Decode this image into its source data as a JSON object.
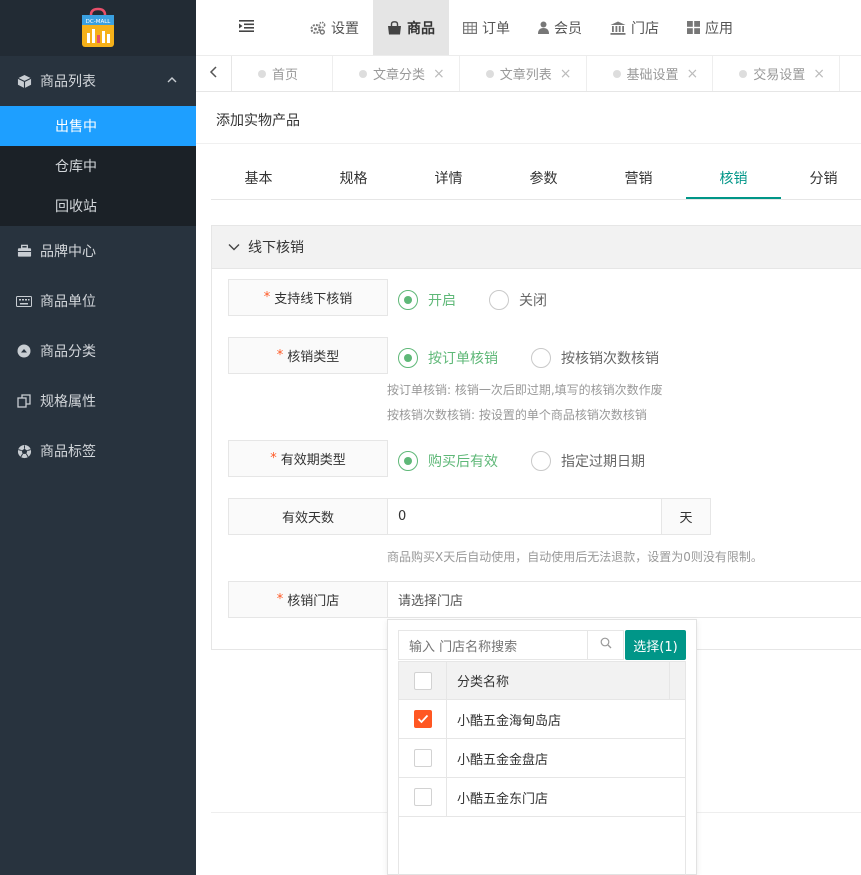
{
  "logo": {
    "text": "DC-MALL"
  },
  "sidebar": {
    "groups": [
      {
        "label": "商品列表",
        "icon": "cube-icon",
        "open": true,
        "items": [
          {
            "label": "出售中",
            "active": true
          },
          {
            "label": "仓库中",
            "active": false
          },
          {
            "label": "回收站",
            "active": false
          }
        ]
      },
      {
        "label": "品牌中心",
        "icon": "briefcase-icon"
      },
      {
        "label": "商品单位",
        "icon": "keyboard-icon"
      },
      {
        "label": "商品分类",
        "icon": "caret-circle-icon"
      },
      {
        "label": "规格属性",
        "icon": "copy-icon"
      },
      {
        "label": "商品标签",
        "icon": "football-icon"
      }
    ]
  },
  "topnav": {
    "items": [
      {
        "label": "设置",
        "icon": "gears-icon",
        "active": false
      },
      {
        "label": "商品",
        "icon": "bag-icon",
        "active": true
      },
      {
        "label": "订单",
        "icon": "table-icon",
        "active": false
      },
      {
        "label": "会员",
        "icon": "user-icon",
        "active": false
      },
      {
        "label": "门店",
        "icon": "bank-icon",
        "active": false
      },
      {
        "label": "应用",
        "icon": "grid-icon",
        "active": false
      }
    ]
  },
  "pagetabs": [
    {
      "label": "首页",
      "closable": false
    },
    {
      "label": "文章分类",
      "closable": true
    },
    {
      "label": "文章列表",
      "closable": true
    },
    {
      "label": "基础设置",
      "closable": true
    },
    {
      "label": "交易设置",
      "closable": true
    },
    {
      "label": "",
      "closable": false
    }
  ],
  "breadcrumb": "添加实物产品",
  "section_tabs": [
    {
      "label": "基本",
      "active": false
    },
    {
      "label": "规格",
      "active": false
    },
    {
      "label": "详情",
      "active": false
    },
    {
      "label": "参数",
      "active": false
    },
    {
      "label": "营销",
      "active": false
    },
    {
      "label": "核销",
      "active": true
    },
    {
      "label": "分销",
      "active": false
    }
  ],
  "panel": {
    "title": "线下核销",
    "support": {
      "label": "支持线下核销",
      "options": [
        "开启",
        "关闭"
      ],
      "selected": 0
    },
    "type": {
      "label": "核销类型",
      "options": [
        "按订单核销",
        "按核销次数核销"
      ],
      "selected": 0,
      "hints": [
        "按订单核销: 核销一次后即过期,填写的核销次数作废",
        "按核销次数核销: 按设置的单个商品核销次数核销"
      ]
    },
    "validity": {
      "label": "有效期类型",
      "options": [
        "购买后有效",
        "指定过期日期"
      ],
      "selected": 0
    },
    "days": {
      "label": "有效天数",
      "value": "0",
      "suffix": "天",
      "hint": "商品购买X天后自动使用，自动使用后无法退款，设置为0则没有限制。"
    },
    "store": {
      "label": "核销门店",
      "placeholder": "请选择门店"
    }
  },
  "dropdown": {
    "search_placeholder": "输入 门店名称搜索",
    "select_button": "选择(1)",
    "column_header": "分类名称",
    "rows": [
      {
        "name": "小酷五金海甸岛店",
        "checked": true
      },
      {
        "name": "小酷五金金盘店",
        "checked": false
      },
      {
        "name": "小酷五金东门店",
        "checked": false
      }
    ]
  },
  "colors": {
    "accent_teal": "#009688",
    "active_blue": "#1e9fff",
    "radio_green": "#5fb878",
    "check_orange": "#ff5722",
    "sidebar_bg": "#28333e"
  }
}
